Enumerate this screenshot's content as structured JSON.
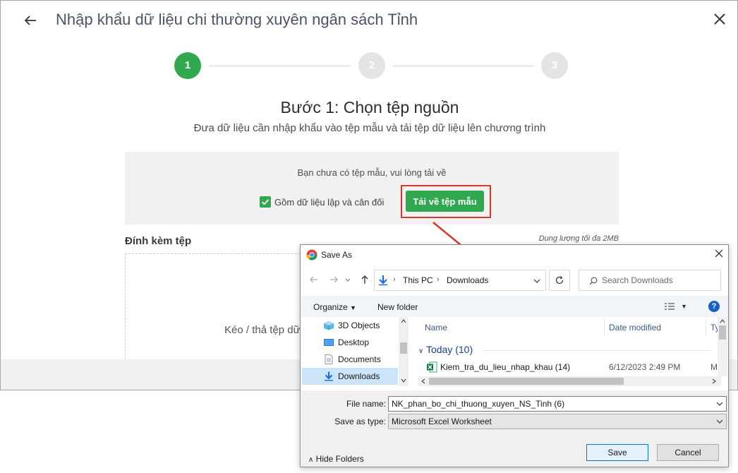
{
  "window": {
    "title": "Nhập khẩu dữ liệu chi thường xuyên ngân sách Tỉnh"
  },
  "steps": [
    {
      "number": "1",
      "active": true
    },
    {
      "number": "2",
      "active": false
    },
    {
      "number": "3",
      "active": false
    }
  ],
  "step1": {
    "heading": "Bước 1: Chọn tệp nguồn",
    "subtitle": "Đưa dữ liệu cần nhập khẩu vào tệp mẫu và tải tệp dữ liệu lên chương trình"
  },
  "template": {
    "note": "Bạn chưa có tệp mẫu, vui lòng tải về",
    "checkbox_label": "Gồm dữ liệu lập và cân đối",
    "checkbox_checked": true,
    "download_button": "Tải về tệp mẫu"
  },
  "attach": {
    "label": "Đính kèm tệp",
    "max_size": "Dung lượng tối đa 2MB",
    "drop_text": "Kéo / thả tệp dữ"
  },
  "save_dialog": {
    "title": "Save As",
    "address": [
      "This PC",
      "Downloads"
    ],
    "search_placeholder": "Search Downloads",
    "toolbar": {
      "organize": "Organize",
      "new_folder": "New folder"
    },
    "nav_items": [
      {
        "label": "3D Objects",
        "icon": "3d-objects-icon",
        "selected": false
      },
      {
        "label": "Desktop",
        "icon": "desktop-icon",
        "selected": false
      },
      {
        "label": "Documents",
        "icon": "documents-icon",
        "selected": false
      },
      {
        "label": "Downloads",
        "icon": "downloads-icon",
        "selected": true
      }
    ],
    "columns": {
      "name": "Name",
      "date_modified": "Date modified",
      "type": "Ty"
    },
    "group": "Today (10)",
    "files": [
      {
        "name": "Kiem_tra_du_lieu_nhap_khau (14)",
        "date": "6/12/2023 2:49 PM",
        "type": "M"
      }
    ],
    "file_name_label": "File name:",
    "file_name_value": "NK_phan_bo_chi_thuong_xuyen_NS_Tinh (6)",
    "save_type_label": "Save as type:",
    "save_type_value": "Microsoft Excel Worksheet",
    "hide_folders": "Hide Folders",
    "save_button": "Save",
    "cancel_button": "Cancel"
  },
  "colors": {
    "accent_green": "#2fa84f",
    "highlight_red": "#d9352f",
    "title_text": "#4a5468",
    "windows_blue": "#1760c6"
  }
}
